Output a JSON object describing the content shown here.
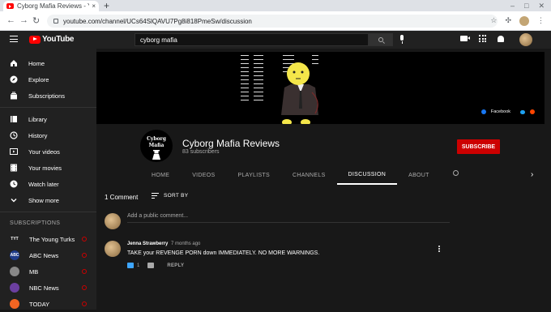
{
  "browser": {
    "tab_title": "Cyborg Mafia Reviews - YouTube",
    "tab_close": "×",
    "new_tab": "+",
    "url": "youtube.com/channel/UCs64SlQAVU7Pg8i818PmeSw/discussion"
  },
  "header": {
    "brand": "YouTube",
    "search_value": "cyborg mafia"
  },
  "sidebar": {
    "items": [
      {
        "label": "Home",
        "icon": "home-icon"
      },
      {
        "label": "Explore",
        "icon": "compass-icon"
      },
      {
        "label": "Subscriptions",
        "icon": "subscriptions-icon"
      },
      {
        "label": "Library",
        "icon": "library-icon"
      },
      {
        "label": "History",
        "icon": "history-icon"
      },
      {
        "label": "Your videos",
        "icon": "video-icon"
      },
      {
        "label": "Your movies",
        "icon": "movies-icon"
      },
      {
        "label": "Watch later",
        "icon": "clock-icon"
      },
      {
        "label": "Show more",
        "icon": "chevron-down-icon"
      }
    ],
    "subscriptions_heading": "SUBSCRIPTIONS",
    "subscriptions": [
      {
        "label": "The Young Turks",
        "avatar": "TYT",
        "color": "#212121"
      },
      {
        "label": "ABC News",
        "avatar": "ABC",
        "color": "#1e3b8a"
      },
      {
        "label": "MB",
        "avatar": "",
        "color": "#888888"
      },
      {
        "label": "NBC News",
        "avatar": "",
        "color": "#6b3fa0"
      },
      {
        "label": "TODAY",
        "avatar": "",
        "color": "#f26522"
      }
    ]
  },
  "banner": {
    "links": [
      "Facebook"
    ]
  },
  "channel": {
    "avatar_text": "Cyborg Mafia",
    "name": "Cyborg Mafia Reviews",
    "subscribers": "83 subscribers",
    "subscribe_label": "SUBSCRIBE",
    "tabs": [
      "HOME",
      "VIDEOS",
      "PLAYLISTS",
      "CHANNELS",
      "DISCUSSION",
      "ABOUT"
    ],
    "active_tab": "DISCUSSION"
  },
  "discussion": {
    "count_label": "1 Comment",
    "sort_label": "SORT BY",
    "add_placeholder": "Add a public comment...",
    "comment": {
      "author": "Jenna Strawberry",
      "time": "7 months ago",
      "text": "TAKE your REVENGE PORN down IMMEDIATELY. NO MORE WARNINGS.",
      "likes": "1",
      "reply_label": "REPLY"
    }
  },
  "colors": {
    "accent": "#cc0000",
    "background": "#181818",
    "surface": "#212121",
    "like_blue": "#3ea6ff"
  }
}
